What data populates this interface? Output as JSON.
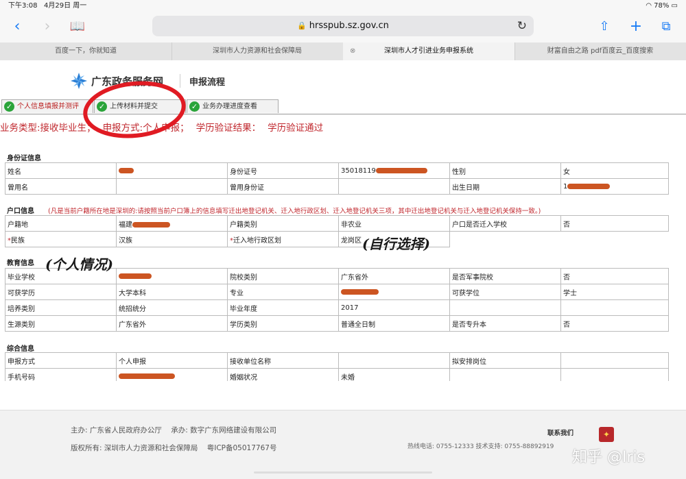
{
  "status_bar": {
    "time": "下午3:08",
    "date": "4月29日 周一",
    "wifi": "wifi-icon",
    "battery": "78%"
  },
  "browser": {
    "url": "hrsspub.sz.gov.cn",
    "tabs": [
      {
        "label": "百度一下，你就知道"
      },
      {
        "label": "深圳市人力资源和社会保障局"
      },
      {
        "label": "深圳市人才引进业务申报系统",
        "active": true
      },
      {
        "label": "财富自由之路 pdf百度云_百度搜索"
      }
    ]
  },
  "header": {
    "logo_text": "广东政务服务网",
    "flow_title": "申报流程"
  },
  "steps": [
    {
      "label": "个人信息填报并测评"
    },
    {
      "label": "上传材料并提交"
    },
    {
      "label": "业务办理进度查看"
    }
  ],
  "business": {
    "type": "业务类型:接收毕业生；",
    "method": "申报方式:个人申报；",
    "edu_label": "学历验证结果：",
    "edu_value": "学历验证通过"
  },
  "identity": {
    "title": "身份证信息",
    "name_label": "姓名",
    "id_label": "身份证号",
    "id_value": "35018119",
    "gender_label": "性别",
    "gender_value": "女",
    "former_name_label": "曾用名",
    "former_id_label": "曾用身份证",
    "birth_label": "出生日期",
    "birth_value": "1"
  },
  "household": {
    "title": "户口信息",
    "note": "(凡是当前户籍所在地是深圳的:请按照当前户口簿上的信息填写迁出地登记机关、迁入地行政区划、迁入地登记机关三项，其中迁出地登记机关与迁入地登记机关保持一致。)",
    "origin_label": "户籍地",
    "origin_value": "福建",
    "type_label": "户籍类别",
    "type_value": "非农业",
    "school_label": "户口是否迁入学校",
    "school_value": "否",
    "ethnic_label": "民族",
    "ethnic_value": "汉族",
    "district_label": "迁入地行政区划",
    "district_value": "龙岗区",
    "required_mark": "*"
  },
  "education": {
    "title": "教育信息",
    "school_label": "毕业学校",
    "school_type_label": "院校类别",
    "school_type_value": "广东省外",
    "military_label": "是否军事院校",
    "military_value": "否",
    "degree_label": "可获学历",
    "degree_value": "大学本科",
    "major_label": "专业",
    "diploma_label": "可获学位",
    "diploma_value": "学士",
    "training_label": "培养类别",
    "training_value": "统招统分",
    "year_label": "毕业年度",
    "year_value": "2017",
    "source_label": "生源类别",
    "source_value": "广东省外",
    "edu_type_label": "学历类别",
    "edu_type_value": "普通全日制",
    "upgrade_label": "是否专升本",
    "upgrade_value": "否"
  },
  "general": {
    "title": "综合信息",
    "method_label": "申报方式",
    "method_value": "个人申报",
    "unit_label": "接收单位名称",
    "post_label": "拟安排岗位",
    "phone_label": "手机号码",
    "marital_label": "婚姻状况",
    "marital_value": "未婚"
  },
  "annotations": {
    "personal": "(个人情况)",
    "self_select": "(自行选择)"
  },
  "footer": {
    "host": "主办: 广东省人民政府办公厅",
    "organizer": "承办: 数字广东网络建设有限公司",
    "copyright": "版权所有: 深圳市人力资源和社会保障局",
    "icp": "粤ICP备05017767号",
    "contact": "联系我们",
    "phone": "热线电话: 0755-12333 技术支持: 0755-88892919",
    "watermark": "知乎 @Iris"
  },
  "colors": {
    "accent": "#1a7cf5",
    "red": "#c0272d",
    "check": "#2aa43a"
  }
}
